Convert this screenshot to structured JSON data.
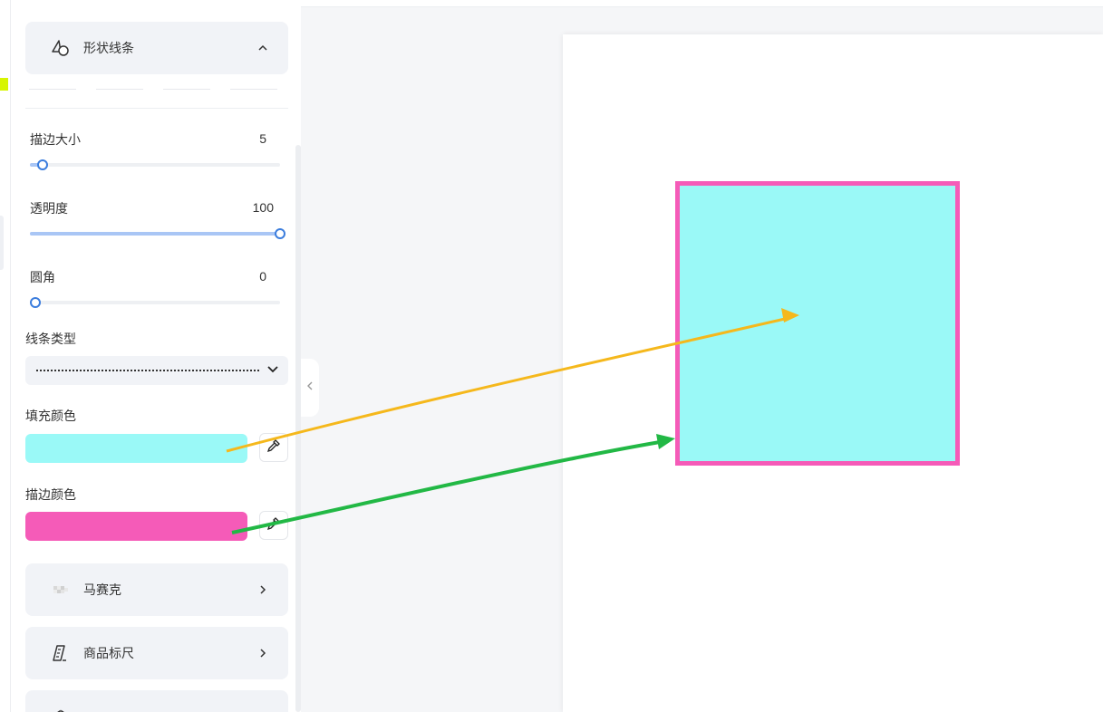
{
  "panel": {
    "shape_section": {
      "title": "形状线条",
      "icon": "shape-icon",
      "state_icon": "chevron-up-icon"
    },
    "stroke_size": {
      "label": "描边大小",
      "value": "5",
      "min": 0,
      "max": 100,
      "level": 5
    },
    "opacity": {
      "label": "透明度",
      "value": "100",
      "min": 0,
      "max": 100,
      "level": 100
    },
    "corner_radius": {
      "label": "圆角",
      "value": "0",
      "min": 0,
      "max": 100,
      "level": 0
    },
    "line_type": {
      "label": "线条类型",
      "selected": "dotted",
      "icon": "chevron-down-icon"
    },
    "fill_color": {
      "label": "填充颜色",
      "color": "#9af9f7",
      "picker_icon": "eyedropper-icon"
    },
    "stroke_color": {
      "label": "描边颜色",
      "color": "#f55bb8",
      "picker_icon": "eyedropper-icon"
    },
    "mosaic_section": {
      "title": "马赛克",
      "icon": "mosaic-icon",
      "state_icon": "chevron-right-icon"
    },
    "ruler_section": {
      "title": "商品标尺",
      "icon": "ruler-icon",
      "state_icon": "chevron-right-icon"
    },
    "next_section": {
      "title": "",
      "icon": "grid-icon"
    }
  },
  "canvas": {
    "shape": {
      "type": "rectangle",
      "fill": "#9af9f7",
      "stroke": "#f55bb8"
    },
    "annotations": [
      {
        "name": "fill-color-arrow",
        "color": "#f5b81c"
      },
      {
        "name": "stroke-color-arrow",
        "color": "#22b845"
      }
    ]
  },
  "accent_color": "#3b7ddd"
}
